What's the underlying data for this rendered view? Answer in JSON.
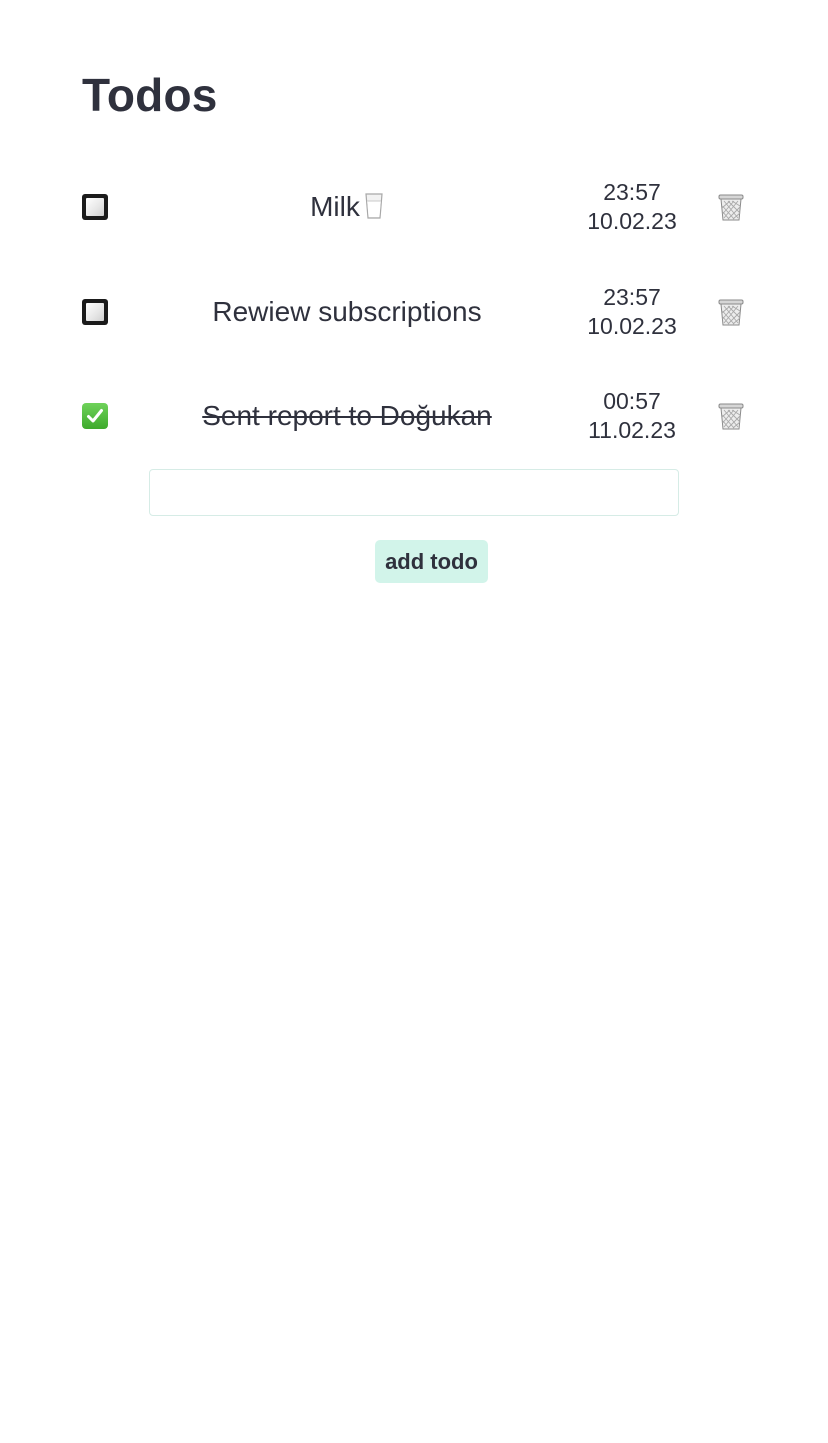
{
  "page": {
    "title": "Todos"
  },
  "todos": [
    {
      "text": "Milk",
      "icon": "milk-glass-icon",
      "completed": false,
      "time": "23:57",
      "date": "10.02.23"
    },
    {
      "text": "Rewiew subscriptions",
      "completed": false,
      "time": "23:57",
      "date": "10.02.23"
    },
    {
      "text": "Sent report to Doğukan",
      "completed": true,
      "time": "00:57",
      "date": "11.02.23"
    }
  ],
  "new_todo": {
    "value": "",
    "placeholder": ""
  },
  "add_button": {
    "label": "add todo"
  },
  "colors": {
    "text": "#2f313d",
    "button_bg": "#d2f4ea",
    "input_border": "#d6ece6",
    "check_green": "#3eaa2c"
  }
}
